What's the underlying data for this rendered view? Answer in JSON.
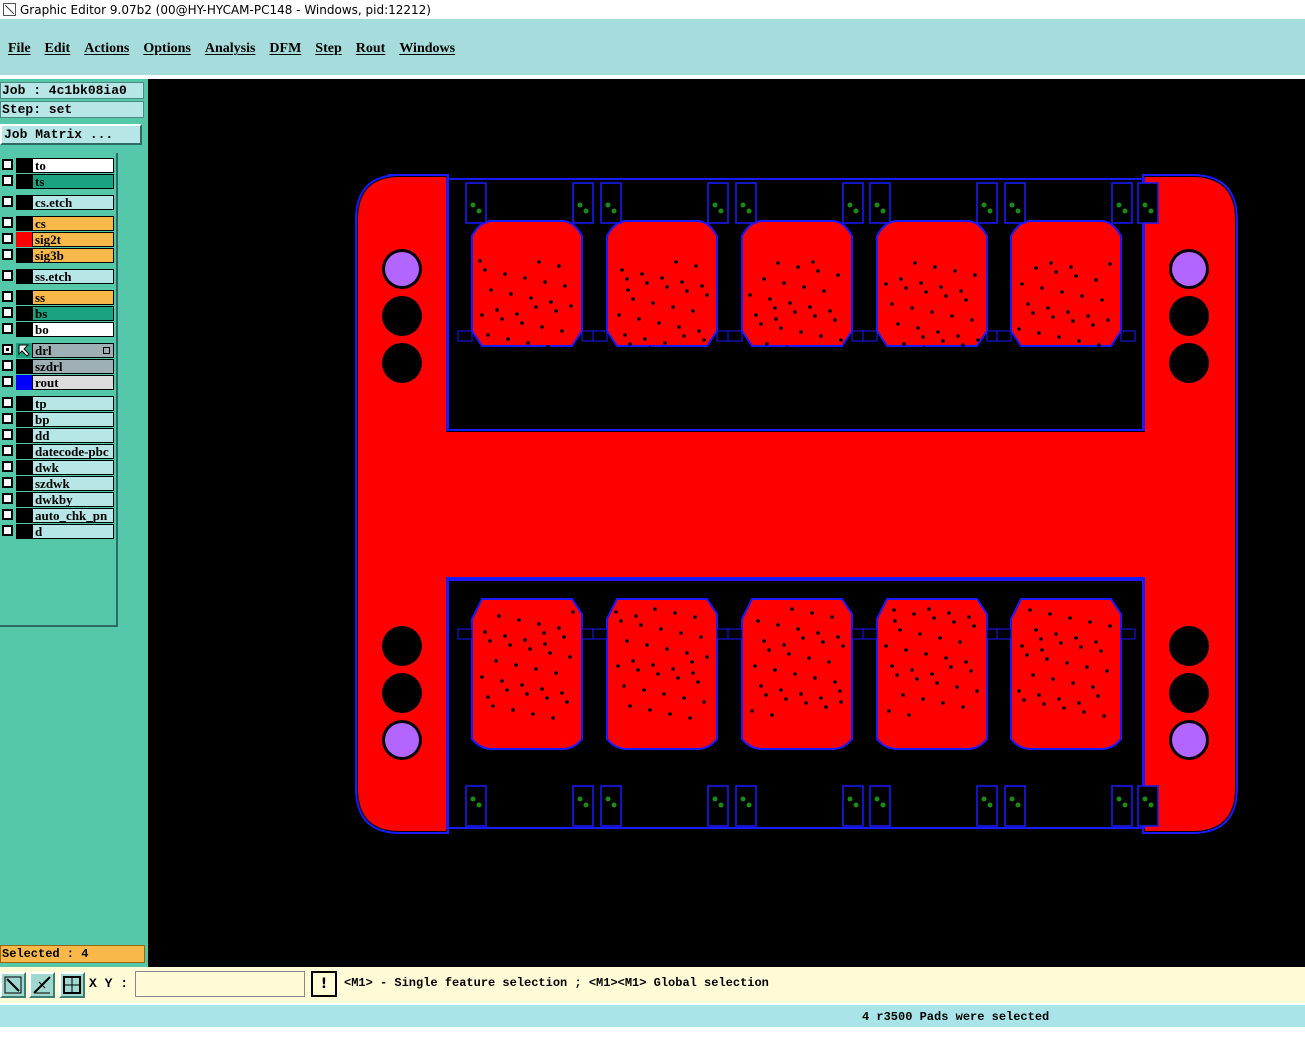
{
  "window": {
    "title": "Graphic Editor 9.07b2 (00@HY-HYCAM-PC148 - Windows, pid:12212)"
  },
  "menu": [
    "File",
    "Edit",
    "Actions",
    "Options",
    "Analysis",
    "DFM",
    "Step",
    "Rout",
    "Windows"
  ],
  "job": {
    "label": "Job : 4c1bk08ia0",
    "step": "Step: set",
    "matrix_button": "Job Matrix ..."
  },
  "layers": [
    {
      "name": "to",
      "bg": "#ffffff",
      "cell": "#000000"
    },
    {
      "name": "ts",
      "bg": "#1aa37e",
      "cell": "#000000"
    },
    {
      "name": "cs.etch",
      "bg": "#b7e6e6",
      "cell": "#000000"
    },
    {
      "name": "cs",
      "bg": "#f8b84a",
      "cell": "#000000"
    },
    {
      "name": "sig2t",
      "bg": "#f8b84a",
      "cell": "#ff0000"
    },
    {
      "name": "sig3b",
      "bg": "#f8b84a",
      "cell": "#000000"
    },
    {
      "name": "ss.etch",
      "bg": "#b7e6e6",
      "cell": "#000000"
    },
    {
      "name": "ss",
      "bg": "#f8b84a",
      "cell": "#000000"
    },
    {
      "name": "bs",
      "bg": "#1aa37e",
      "cell": "#000000"
    },
    {
      "name": "bo",
      "bg": "#ffffff",
      "cell": "#000000"
    },
    {
      "name": "drl",
      "bg": "#9fb0b4",
      "cell": "#000000"
    },
    {
      "name": "szdrl",
      "bg": "#9fb0b4",
      "cell": "#000000"
    },
    {
      "name": "rout",
      "bg": "#dcdcdc",
      "cell": "#0000ff"
    },
    {
      "name": "tp",
      "bg": "#b7e6e6",
      "cell": "#000000"
    },
    {
      "name": "bp",
      "bg": "#b7e6e6",
      "cell": "#000000"
    },
    {
      "name": "dd",
      "bg": "#b7e6e6",
      "cell": "#000000"
    },
    {
      "name": "datecode-pbc",
      "bg": "#b7e6e6",
      "cell": "#000000"
    },
    {
      "name": "dwk",
      "bg": "#b7e6e6",
      "cell": "#000000"
    },
    {
      "name": "szdwk",
      "bg": "#b7e6e6",
      "cell": "#000000"
    },
    {
      "name": "dwkby",
      "bg": "#b7e6e6",
      "cell": "#000000"
    },
    {
      "name": "auto_chk_pn",
      "bg": "#b7e6e6",
      "cell": "#000000"
    },
    {
      "name": "d",
      "bg": "#b7e6e6",
      "cell": "#000000"
    }
  ],
  "selected": "Selected : 4",
  "xy_label": "X Y :",
  "xy_value": "",
  "hint": "<M1> - Single feature selection ; <M1><M1> Global selection",
  "status": "4 r3500 Pads were selected",
  "colors": {
    "copper": "#ff0000",
    "rout": "#1a1aff",
    "pad": "#b266ff",
    "via": "#1a8a1a",
    "menu_bg": "#a6dcdc",
    "panel_bg": "#56c8aa"
  }
}
